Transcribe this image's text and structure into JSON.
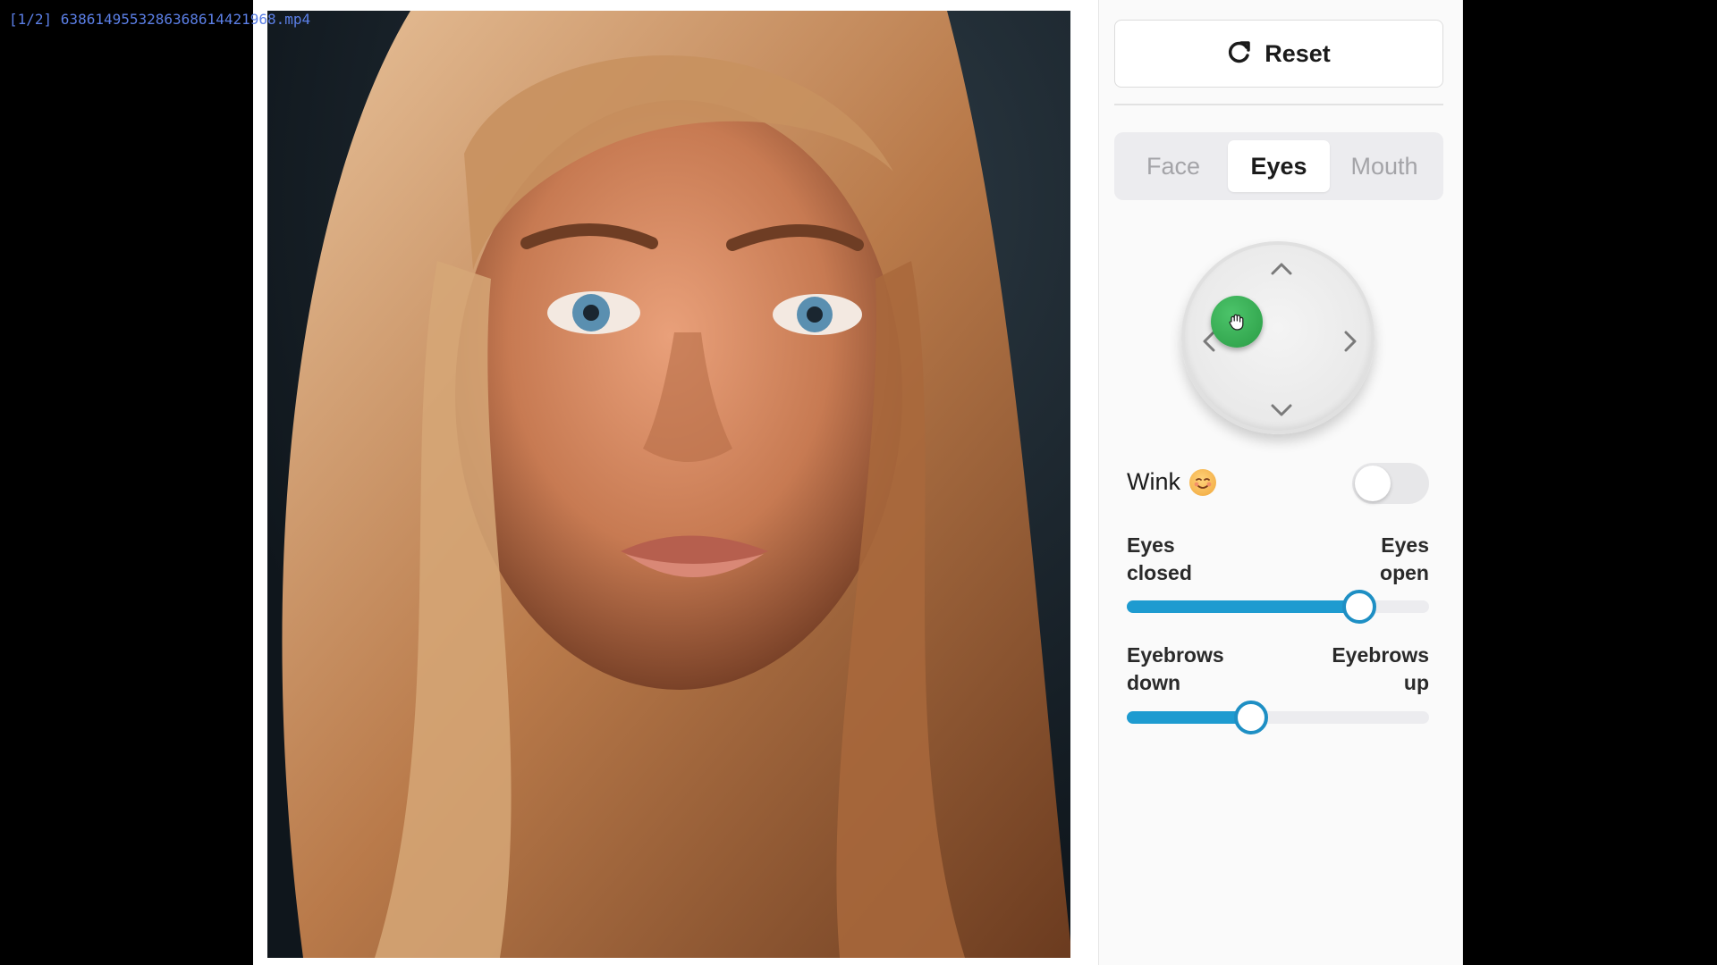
{
  "player": {
    "file_label": "[1/2] 638614955328636861442​1968.mp4"
  },
  "colors": {
    "accent": "#1e9bd0",
    "knob_green": "#2a9c45",
    "panel_bg": "#fafafa"
  },
  "reset": {
    "label": "Reset",
    "icon": "refresh-icon"
  },
  "tabs": [
    {
      "label": "Face",
      "active": false
    },
    {
      "label": "Eyes",
      "active": true
    },
    {
      "label": "Mouth",
      "active": false
    }
  ],
  "joystick": {
    "icon": "grab-hand-icon"
  },
  "wink": {
    "label": "Wink",
    "icon": "wink-emoji-icon",
    "enabled": false
  },
  "sliders": [
    {
      "left_label_1": "Eyes",
      "left_label_2": "closed",
      "right_label_1": "Eyes",
      "right_label_2": "open",
      "value": 0.77
    },
    {
      "left_label_1": "Eyebrows",
      "left_label_2": "down",
      "right_label_1": "Eyebrows",
      "right_label_2": "up",
      "value": 0.41
    }
  ]
}
